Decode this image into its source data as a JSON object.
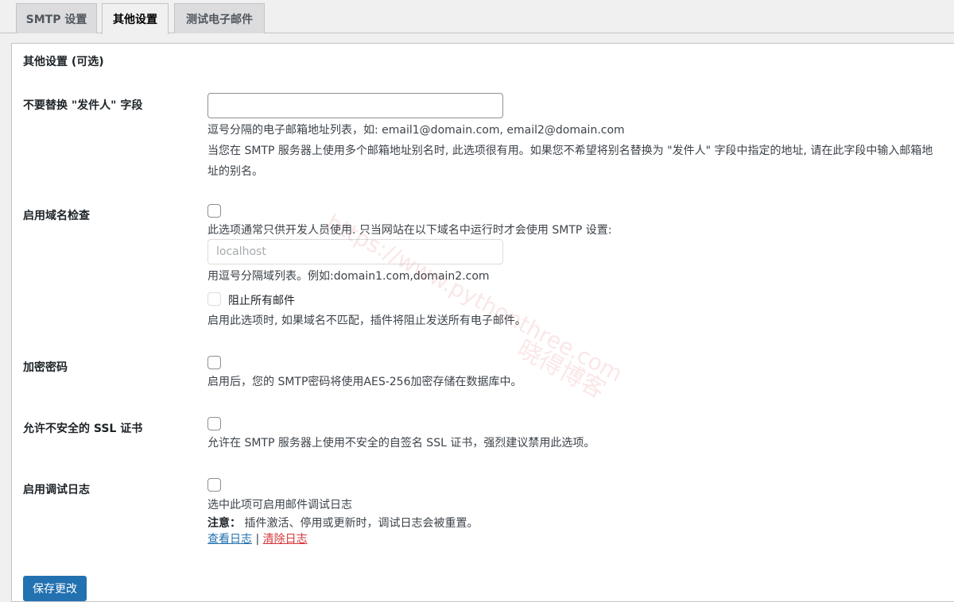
{
  "tabs": [
    {
      "label": "SMTP 设置",
      "active": false
    },
    {
      "label": "其他设置",
      "active": true
    },
    {
      "label": "测试电子邮件",
      "active": false
    }
  ],
  "section_title": "其他设置 (可选)",
  "rows": {
    "from_field": {
      "label": "不要替换 \"发件人\" 字段",
      "value": "",
      "desc1": "逗号分隔的电子邮箱地址列表，如: email1@domain.com, email2@domain.com",
      "desc2": "当您在 SMTP 服务器上使用多个邮箱地址别名时, 此选项很有用。如果您不希望将别名替换为 \"发件人\" 字段中指定的地址, 请在此字段中输入邮箱地址的别名。"
    },
    "domain_check": {
      "label": "启用域名检查",
      "checked": false,
      "desc1": "此选项通常只供开发人员使用. 只当网站在以下域名中运行时才会使用 SMTP 设置:",
      "domain_placeholder": "localhost",
      "desc2": "用逗号分隔域列表。例如:domain1.com,domain2.com",
      "block_label": "阻止所有邮件",
      "block_checked": false,
      "desc3": "启用此选项时, 如果域名不匹配，插件将阻止发送所有电子邮件。"
    },
    "encrypt_password": {
      "label": "加密密码",
      "checked": false,
      "desc": "启用后，您的 SMTP密码将使用AES-256加密存储在数据库中。"
    },
    "insecure_ssl": {
      "label": "允许不安全的 SSL 证书",
      "checked": false,
      "desc": "允许在 SMTP 服务器上使用不安全的自签名 SSL 证书，强烈建议禁用此选项。"
    },
    "debug_log": {
      "label": "启用调试日志",
      "checked": false,
      "desc": "选中此项可启用邮件调试日志",
      "note_label": "注意：",
      "note_text": " 插件激活、停用或更新时，调试日志会被重置。",
      "view_log": "查看日志",
      "separator": " | ",
      "clear_log": "清除日志"
    }
  },
  "save_button": "保存更改",
  "watermark": {
    "url": "https://www.pythonthree.com",
    "name": "晓得博客"
  }
}
